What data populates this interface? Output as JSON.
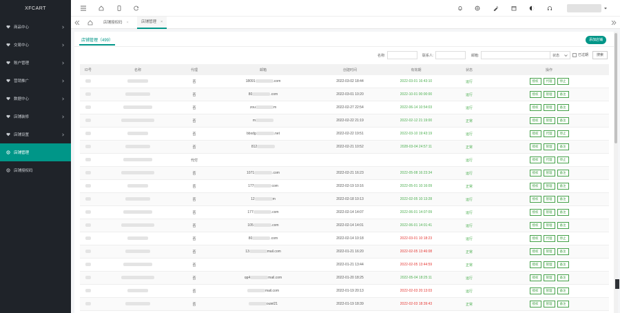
{
  "app": {
    "logo": "XFCART"
  },
  "sidebar": {
    "items": [
      {
        "label": "商品中心",
        "icon": "heart-icon",
        "has_arrow": true,
        "active": false
      },
      {
        "label": "交易中心",
        "icon": "heart-icon",
        "has_arrow": true,
        "active": false
      },
      {
        "label": "账户管理",
        "icon": "heart-icon",
        "has_arrow": true,
        "active": false
      },
      {
        "label": "营销推广",
        "icon": "heart-icon",
        "has_arrow": true,
        "active": false
      },
      {
        "label": "数据中心",
        "icon": "heart-icon",
        "has_arrow": true,
        "active": false
      },
      {
        "label": "店铺装修",
        "icon": "heart-icon",
        "has_arrow": true,
        "active": false
      },
      {
        "label": "店铺设置",
        "icon": "heart-icon",
        "has_arrow": true,
        "active": false
      },
      {
        "label": "店铺管理",
        "icon": "gear-icon",
        "has_arrow": false,
        "active": true
      },
      {
        "label": "店铺授权码",
        "icon": "gear-icon",
        "has_arrow": false,
        "active": false
      }
    ]
  },
  "topbar": {
    "icons": [
      "menu-toggle-icon",
      "home-icon",
      "mobile-icon",
      "refresh-icon"
    ],
    "right_icons": [
      "bell-icon",
      "globe-icon",
      "paint-icon",
      "calendar-icon",
      "theme-icon",
      "headphone-icon"
    ]
  },
  "tabs": [
    {
      "label": "店铺授权码",
      "active": false
    },
    {
      "label": "店铺管理",
      "active": true
    }
  ],
  "page": {
    "subtab": "店铺管理（499）",
    "add_button": "添加店铺",
    "filters": {
      "name_label": "名称:",
      "contact_label": "联系人:",
      "email_label": "邮箱:",
      "status_select": "状态",
      "expired_label": "已过期",
      "search_button": "搜索"
    }
  },
  "table": {
    "headers": [
      "ID号",
      "名称",
      "代理",
      "邮箱",
      "创建时间",
      "有效期",
      "状态",
      "操作"
    ],
    "rows": [
      {
        "agent": "否",
        "email_prefix": "18",
        "email_mid": "091",
        "email_suffix": ".com",
        "created": "2022-03-02 18:44",
        "expire": "2022-03-01 16:43:10",
        "exp_color": "green",
        "status": "运行",
        "ops": [
          "授权",
          "代理",
          "停止"
        ]
      },
      {
        "agent": "否",
        "email_prefix": "80",
        "email_mid": "",
        "email_suffix": ".com",
        "created": "2022-03-01 10:20",
        "expire": "2022-10-01 00:00:00",
        "exp_color": "green",
        "status": "运行",
        "ops": [
          "授权",
          "管理",
          "备注"
        ]
      },
      {
        "agent": "否",
        "email_prefix": "zou",
        "email_mid": "",
        "email_suffix": "m",
        "created": "2022-02-27 22:54",
        "expire": "2022-06-14 10:54:03",
        "exp_color": "green",
        "status": "运行",
        "ops": [
          "授权",
          "管理",
          "备注"
        ]
      },
      {
        "agent": "否",
        "email_prefix": "m",
        "email_mid": "",
        "email_suffix": "",
        "created": "2022-02-22 21:19",
        "expire": "2022-02-12 21:19:00",
        "exp_color": "green",
        "status": "正常",
        "ops": [
          "授权",
          "管理",
          "备注"
        ]
      },
      {
        "agent": "否",
        "email_prefix": "bbxdg",
        "email_mid": "",
        "email_suffix": ".net",
        "created": "2022-02-22 19:51",
        "expire": "2022-03-10 19:43:19",
        "exp_color": "green",
        "status": "运行",
        "ops": [
          "授权",
          "代理",
          "停止"
        ]
      },
      {
        "agent": "否",
        "email_prefix": "812",
        "email_mid": "",
        "email_suffix": "",
        "created": "2022-02-21 10:52",
        "expire": "2028-03-04 24:57:11",
        "exp_color": "green",
        "status": "正常",
        "ops": [
          "授权",
          "管理",
          "备注"
        ]
      },
      {
        "agent": "代付",
        "email_prefix": "",
        "email_mid": "",
        "email_suffix": "",
        "created": "",
        "expire": "",
        "exp_color": "green",
        "status": "运行",
        "ops": [
          "授权",
          "代理",
          "停止"
        ]
      },
      {
        "agent": "否",
        "email_prefix": "1071",
        "email_mid": "",
        "email_suffix": ".com",
        "created": "2022-02-21 16:23",
        "expire": "2022-05-08 16:23:34",
        "exp_color": "green",
        "status": "运行",
        "ops": [
          "授权",
          "管理",
          "备注"
        ]
      },
      {
        "agent": "否",
        "email_prefix": "177",
        "email_mid": "",
        "email_suffix": "com",
        "created": "2022-02-19 10:16",
        "expire": "2022-05-01 10:16:09",
        "exp_color": "green",
        "status": "正常",
        "ops": [
          "授权",
          "管理",
          "备注"
        ]
      },
      {
        "agent": "否",
        "email_prefix": "12",
        "email_mid": "",
        "email_suffix": "m",
        "created": "2022-02-18 10:13",
        "expire": "2022-02-05 10:13:28",
        "exp_color": "green",
        "status": "运行",
        "ops": [
          "授权",
          "管理",
          "备注"
        ]
      },
      {
        "agent": "否",
        "email_prefix": "177",
        "email_mid": "",
        "email_suffix": ".com",
        "created": "2022-02-14 14:07",
        "expire": "2022-06-01 14:07:09",
        "exp_color": "green",
        "status": "运行",
        "ops": [
          "授权",
          "管理",
          "备注"
        ]
      },
      {
        "agent": "否",
        "email_prefix": "105",
        "email_mid": "",
        "email_suffix": ".com",
        "created": "2022-02-14 14:01",
        "expire": "2022-06-01 14:01:41",
        "exp_color": "green",
        "status": "运行",
        "ops": [
          "授权",
          "管理",
          "备注"
        ]
      },
      {
        "agent": "否",
        "email_prefix": "80",
        "email_mid": "",
        "email_suffix": ".com",
        "created": "2022-02-14 10:18",
        "expire": "2022-03-01 10:18:23",
        "exp_color": "red",
        "status": "运行",
        "ops": [
          "授权",
          "代理",
          "停止"
        ]
      },
      {
        "agent": "否",
        "email_prefix": "13",
        "email_mid": "",
        "email_suffix": "mail.com",
        "created": "2022-01-21 16:20",
        "expire": "2022-02-05 13:46:08",
        "exp_color": "red",
        "status": "正常",
        "ops": [
          "授权",
          "管理",
          "备注"
        ]
      },
      {
        "agent": "否",
        "email_prefix": "",
        "email_mid": "",
        "email_suffix": "",
        "created": "2022-01-21 13:44",
        "expire": "2022-02-05 13:44:59",
        "exp_color": "red",
        "status": "正常",
        "ops": [
          "授权",
          "管理",
          "备注"
        ]
      },
      {
        "agent": "否",
        "email_prefix": "qq4",
        "email_mid": "",
        "email_suffix": "mail.com",
        "created": "2022-01-20 18:25",
        "expire": "2022-05-04 18:25:11",
        "exp_color": "green",
        "status": "运行",
        "ops": [
          "授权",
          "管理",
          "备注"
        ]
      },
      {
        "agent": "否",
        "email_prefix": "",
        "email_mid": "",
        "email_suffix": "mail.com",
        "created": "2022-01-19 20:13",
        "expire": "2022-02-03 20:13:03",
        "exp_color": "red",
        "status": "运行",
        "ops": [
          "授权",
          "管理",
          "备注"
        ]
      },
      {
        "agent": "否",
        "email_prefix": "",
        "email_mid": "",
        "email_suffix": "ouiel21",
        "created": "2022-01-19 18:39",
        "expire": "2022-02-03 18:39:43",
        "exp_color": "red",
        "status": "正常",
        "ops": [
          "授权",
          "管理",
          "备注"
        ]
      }
    ]
  }
}
